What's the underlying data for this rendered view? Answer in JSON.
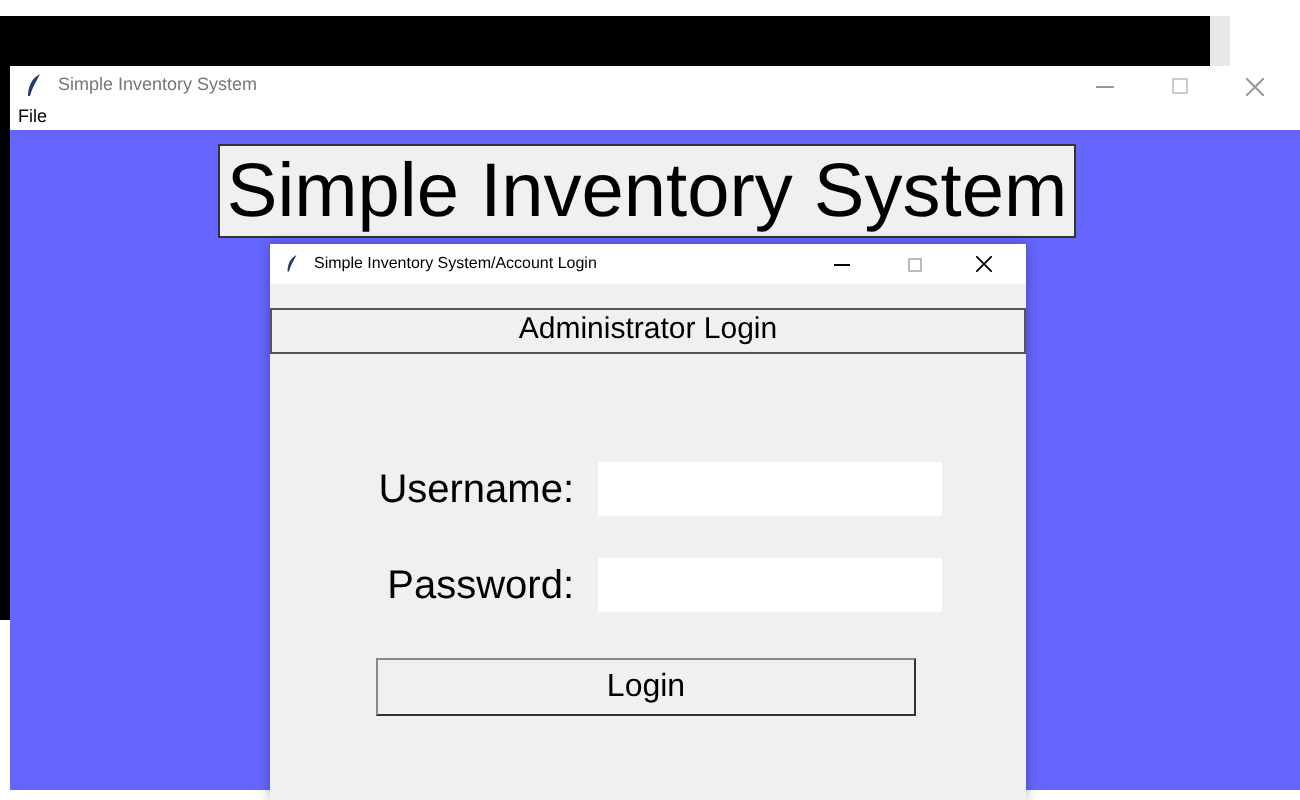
{
  "main_window": {
    "title": "Simple Inventory System",
    "menu": [
      "File"
    ],
    "heading": "Simple Inventory System"
  },
  "dialog": {
    "title": "Simple Inventory System/Account Login",
    "header": "Administrator Login",
    "fields": [
      {
        "label": "Username:"
      },
      {
        "label": "Password:"
      }
    ],
    "button": "Login"
  }
}
